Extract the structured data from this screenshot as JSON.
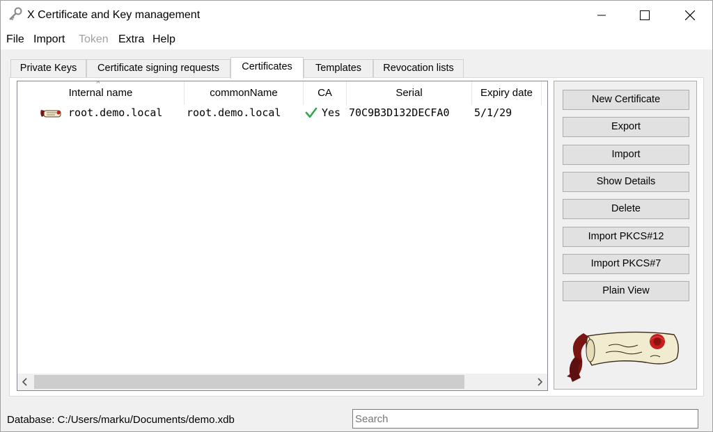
{
  "window": {
    "title": "X Certificate and Key management",
    "icon": "key-icon"
  },
  "menu": {
    "file": "File",
    "import": "Import",
    "token": "Token",
    "extra": "Extra",
    "help": "Help"
  },
  "tabs": [
    {
      "label": "Private Keys",
      "active": false
    },
    {
      "label": "Certificate signing requests",
      "active": false
    },
    {
      "label": "Certificates",
      "active": true
    },
    {
      "label": "Templates",
      "active": false
    },
    {
      "label": "Revocation lists",
      "active": false
    }
  ],
  "table": {
    "columns": [
      "Internal name",
      "commonName",
      "CA",
      "Serial",
      "Expiry date"
    ],
    "sorted_column": "Internal name",
    "rows": [
      {
        "icon": "certificate-icon",
        "internal_name": "root.demo.local",
        "common_name": "root.demo.local",
        "ca_icon": "check-icon",
        "ca": "Yes",
        "serial": "70C9B3D132DECFA0",
        "expiry": "5/1/29"
      }
    ]
  },
  "buttons": {
    "new_certificate": "New Certificate",
    "export": "Export",
    "import": "Import",
    "show_details": "Show Details",
    "delete": "Delete",
    "import_pkcs12": "Import PKCS#12",
    "import_pkcs7": "Import PKCS#7",
    "plain_view": "Plain View"
  },
  "status": {
    "database": "Database: C:/Users/marku/Documents/demo.xdb",
    "search_placeholder": "Search"
  },
  "colors": {
    "check": "#2fa84f",
    "logo_ribbon": "#7a1414",
    "logo_seal": "#c41e1e",
    "scroll_paper": "#f1ecd0"
  }
}
